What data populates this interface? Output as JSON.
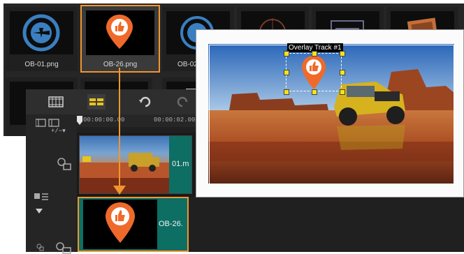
{
  "library": {
    "thumbnails": [
      {
        "caption": "OB-01.png",
        "icon": "airplane-stamp-icon"
      },
      {
        "caption": "OB-26.png",
        "icon": "location-pin-thumbs-up-icon",
        "selected": true
      },
      {
        "caption": "OB-02",
        "icon": "globe-stamp-icon"
      },
      {
        "caption": "",
        "icon": "compass-icon"
      },
      {
        "caption": "",
        "icon": "departed-stamp-icon"
      },
      {
        "caption": "",
        "icon": "postcard-icon"
      }
    ]
  },
  "timeline": {
    "ruler_start": "00:00:00.00",
    "ruler_next": "00:00:02.00",
    "video_clip_label": "01.m",
    "overlay_clip_label": "OB-26."
  },
  "preview": {
    "overlay_label": "Overlay Track #1"
  },
  "colors": {
    "accent": "#f0962e",
    "pin": "#ef6a2a",
    "clip": "#0d6e63",
    "handle": "#f5e31a"
  }
}
